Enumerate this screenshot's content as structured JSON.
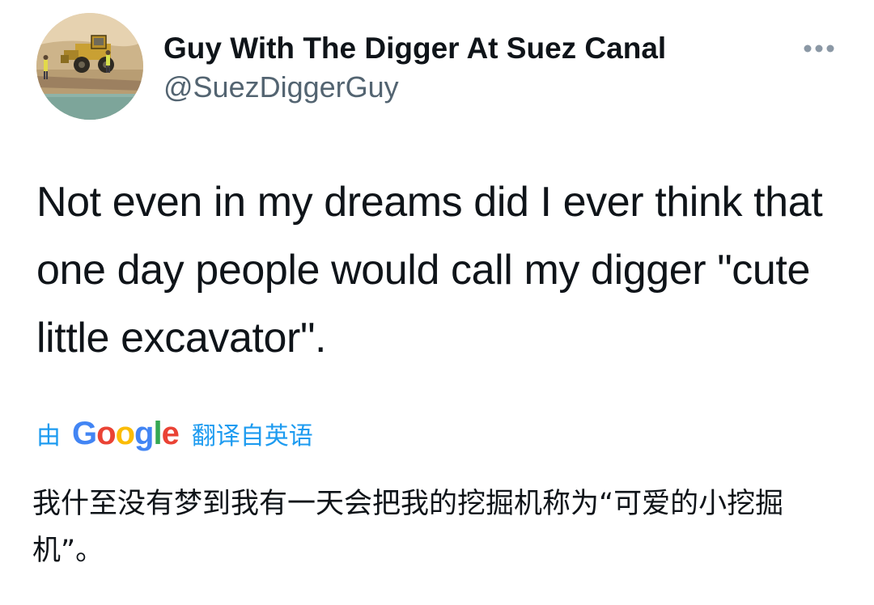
{
  "author": {
    "display_name": "Guy With The Digger At Suez Canal",
    "handle": "@SuezDiggerGuy",
    "avatar_icon": "excavator-photo-avatar"
  },
  "menu": {
    "icon": "more-horizontal-icon"
  },
  "tweet": {
    "text": "Not even in my dreams did I ever think that one day people would call my digger \"cute little excavator\"."
  },
  "translation": {
    "by_label": "由",
    "provider_letters": [
      "G",
      "o",
      "o",
      "g",
      "l",
      "e"
    ],
    "translated_from_label": "翻译自英语",
    "text": "我什至没有梦到我有一天会把我的挖掘机称为“可爱的小挖掘机”。"
  },
  "colors": {
    "link_blue": "#1d9bf0",
    "secondary_text": "#536471",
    "primary_text": "#0f1419",
    "google_blue": "#4285f4",
    "google_red": "#ea4335",
    "google_yellow": "#fbbc05",
    "google_green": "#34a853"
  }
}
